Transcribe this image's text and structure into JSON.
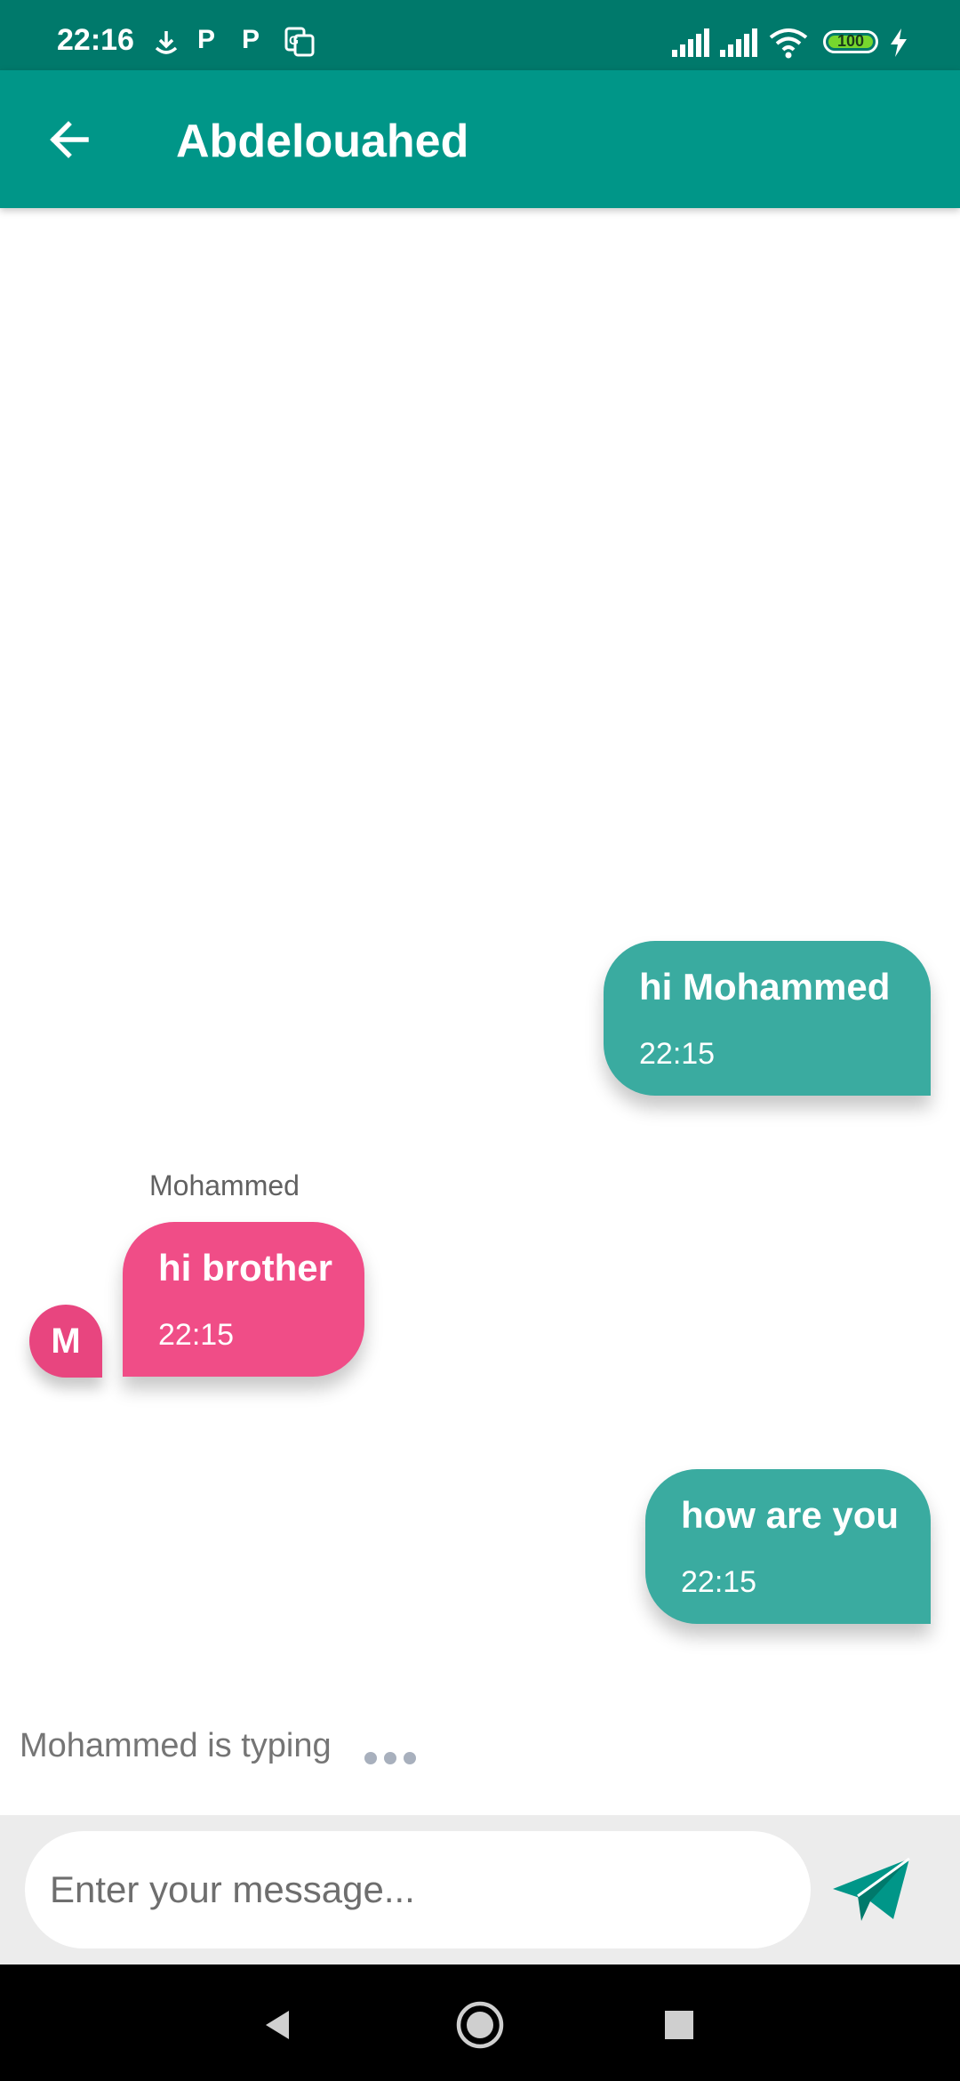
{
  "status_bar": {
    "time": "22:16",
    "battery": "100",
    "icons": [
      "download-icon",
      "parking-icon",
      "parking-icon",
      "translate-icon",
      "signal-icon",
      "signal-icon",
      "wifi-icon",
      "battery-icon",
      "charging-icon"
    ]
  },
  "app_bar": {
    "title": "Abdelouahed",
    "back_icon": "arrow-back-icon"
  },
  "messages": [
    {
      "direction": "outgoing",
      "text": "hi Mohammed",
      "time": "22:15"
    },
    {
      "direction": "incoming",
      "sender": "Mohammed",
      "avatar_initial": "M",
      "text": "hi brother",
      "time": "22:15"
    },
    {
      "direction": "outgoing",
      "text": "how are you",
      "time": "22:15"
    }
  ],
  "typing": {
    "label": "Mohammed is typing"
  },
  "composer": {
    "placeholder": "Enter your message...",
    "value": "",
    "send_icon": "send-icon"
  },
  "nav_bar": {
    "icons": [
      "back-triangle-icon",
      "home-circle-icon",
      "recents-square-icon"
    ]
  },
  "colors": {
    "status_bar": "#00796b",
    "app_bar": "#009688",
    "outgoing_bubble": "#3aaba0",
    "incoming_bubble": "#f04d87",
    "send_icon": "#009688"
  }
}
